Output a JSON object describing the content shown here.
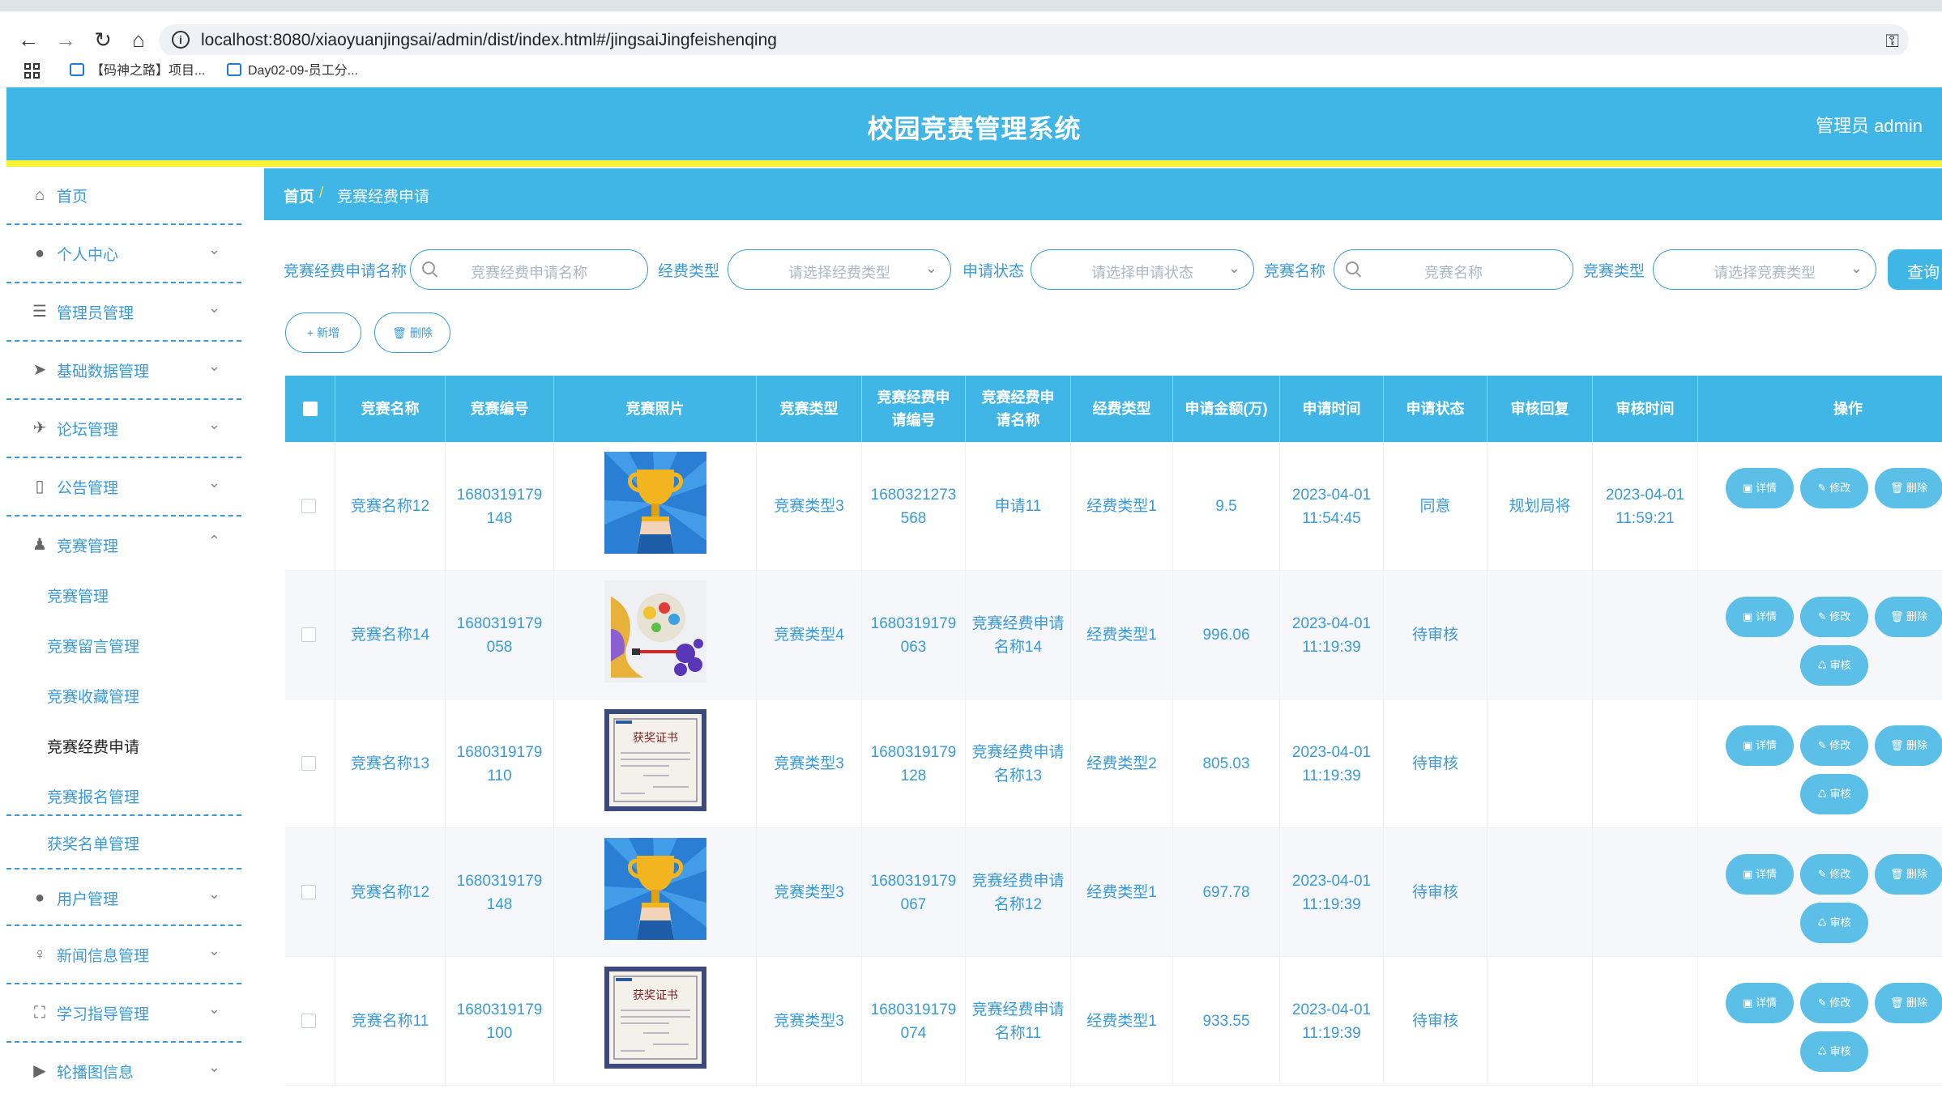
{
  "browser": {
    "url": "localhost:8080/xiaoyuanjingsai/admin/dist/index.html#/jingsaiJingfeishenqing",
    "bookmarks": [
      "【码神之路】项目...",
      "Day02-09-员工分..."
    ]
  },
  "header": {
    "title": "校园竞赛管理系统",
    "user": "管理员 admin"
  },
  "sidebar": {
    "items": [
      {
        "label": "首页",
        "icon": "home-icon"
      },
      {
        "label": "个人中心",
        "icon": "user-icon"
      },
      {
        "label": "管理员管理",
        "icon": "list-icon"
      },
      {
        "label": "基础数据管理",
        "icon": "send-icon"
      },
      {
        "label": "论坛管理",
        "icon": "plane-icon"
      },
      {
        "label": "公告管理",
        "icon": "battery-icon"
      },
      {
        "label": "竞赛管理",
        "icon": "stamp-icon"
      },
      {
        "label": "用户管理",
        "icon": "user-icon"
      },
      {
        "label": "新闻信息管理",
        "icon": "mic-icon"
      },
      {
        "label": "学习指导管理",
        "icon": "fullscreen-icon"
      },
      {
        "label": "轮播图信息",
        "icon": "video-icon"
      }
    ],
    "sub_items": [
      "竞赛管理",
      "竞赛留言管理",
      "竞赛收藏管理",
      "竞赛经费申请",
      "竞赛报名管理",
      "获奖名单管理"
    ]
  },
  "breadcrumb": {
    "home": "首页",
    "sep": "/",
    "current": "竞赛经费申请"
  },
  "filters": {
    "name_label": "竞赛经费申请名称",
    "name_placeholder": "竞赛经费申请名称",
    "fee_type_label": "经费类型",
    "fee_type_placeholder": "请选择经费类型",
    "status_label": "申请状态",
    "status_placeholder": "请选择申请状态",
    "comp_name_label": "竞赛名称",
    "comp_name_placeholder": "竞赛名称",
    "comp_type_label": "竞赛类型",
    "comp_type_placeholder": "请选择竞赛类型",
    "query": "查询"
  },
  "actions": {
    "add": "+ 新增",
    "delete": "删除"
  },
  "table": {
    "headers": [
      "竞赛名称",
      "竞赛编号",
      "竞赛照片",
      "竞赛类型",
      "竞赛经费申请编号",
      "竞赛经费申请名称",
      "经费类型",
      "申请金额(万)",
      "申请时间",
      "申请状态",
      "审核回复",
      "审核时间",
      "操作"
    ],
    "op_labels": {
      "detail": "详情",
      "edit": "修改",
      "delete": "删除",
      "review": "审核"
    },
    "rows": [
      {
        "name": "竞赛名称12",
        "no": "1680319179148",
        "photo": "trophy",
        "type": "竞赛类型3",
        "apply_no": "1680321273568",
        "apply_name": "申请11",
        "fee_type": "经费类型1",
        "amount": "9.5",
        "apply_time": "2023-04-01 11:54:45",
        "status": "同意",
        "reply": "规划局将",
        "review_time": "2023-04-01 11:59:21",
        "reviewable": false
      },
      {
        "name": "竞赛名称14",
        "no": "1680319179058",
        "photo": "art",
        "type": "竞赛类型4",
        "apply_no": "1680319179063",
        "apply_name": "竞赛经费申请名称14",
        "fee_type": "经费类型1",
        "amount": "996.06",
        "apply_time": "2023-04-01 11:19:39",
        "status": "待审核",
        "reply": "",
        "review_time": "",
        "reviewable": true
      },
      {
        "name": "竞赛名称13",
        "no": "1680319179110",
        "photo": "certificate",
        "type": "竞赛类型3",
        "apply_no": "1680319179128",
        "apply_name": "竞赛经费申请名称13",
        "fee_type": "经费类型2",
        "amount": "805.03",
        "apply_time": "2023-04-01 11:19:39",
        "status": "待审核",
        "reply": "",
        "review_time": "",
        "reviewable": true
      },
      {
        "name": "竞赛名称12",
        "no": "1680319179148",
        "photo": "trophy",
        "type": "竞赛类型3",
        "apply_no": "1680319179067",
        "apply_name": "竞赛经费申请名称12",
        "fee_type": "经费类型1",
        "amount": "697.78",
        "apply_time": "2023-04-01 11:19:39",
        "status": "待审核",
        "reply": "",
        "review_time": "",
        "reviewable": true
      },
      {
        "name": "竞赛名称11",
        "no": "1680319179100",
        "photo": "certificate",
        "type": "竞赛类型3",
        "apply_no": "1680319179074",
        "apply_name": "竞赛经费申请名称11",
        "fee_type": "经费类型1",
        "amount": "933.55",
        "apply_time": "2023-04-01 11:19:39",
        "status": "待审核",
        "reply": "",
        "review_time": "",
        "reviewable": true
      }
    ]
  },
  "colors": {
    "primary": "#3fb6e6",
    "accent_yellow": "#f8f337",
    "text_blue": "#3a9ad8"
  }
}
